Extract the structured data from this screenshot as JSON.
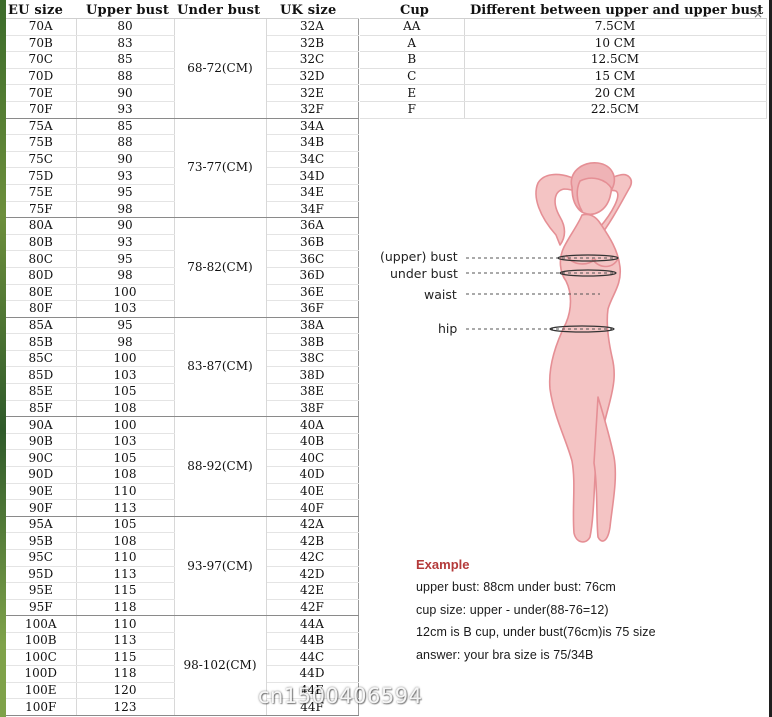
{
  "size_table": {
    "headers": {
      "eu": "EU size",
      "upper": "Upper bust",
      "under": "Under bust",
      "uk": "UK size"
    },
    "groups": [
      {
        "under": "68-72(CM)",
        "rows": [
          {
            "eu": "70A",
            "upper": "80",
            "uk": "32A"
          },
          {
            "eu": "70B",
            "upper": "83",
            "uk": "32B"
          },
          {
            "eu": "70C",
            "upper": "85",
            "uk": "32C"
          },
          {
            "eu": "70D",
            "upper": "88",
            "uk": "32D"
          },
          {
            "eu": "70E",
            "upper": "90",
            "uk": "32E"
          },
          {
            "eu": "70F",
            "upper": "93",
            "uk": "32F"
          }
        ]
      },
      {
        "under": "73-77(CM)",
        "rows": [
          {
            "eu": "75A",
            "upper": "85",
            "uk": "34A"
          },
          {
            "eu": "75B",
            "upper": "88",
            "uk": "34B"
          },
          {
            "eu": "75C",
            "upper": "90",
            "uk": "34C"
          },
          {
            "eu": "75D",
            "upper": "93",
            "uk": "34D"
          },
          {
            "eu": "75E",
            "upper": "95",
            "uk": "34E"
          },
          {
            "eu": "75F",
            "upper": "98",
            "uk": "34F"
          }
        ]
      },
      {
        "under": "78-82(CM)",
        "rows": [
          {
            "eu": "80A",
            "upper": "90",
            "uk": "36A"
          },
          {
            "eu": "80B",
            "upper": "93",
            "uk": "36B"
          },
          {
            "eu": "80C",
            "upper": "95",
            "uk": "36C"
          },
          {
            "eu": "80D",
            "upper": "98",
            "uk": "36D"
          },
          {
            "eu": "80E",
            "upper": "100",
            "uk": "36E"
          },
          {
            "eu": "80F",
            "upper": "103",
            "uk": "36F"
          }
        ]
      },
      {
        "under": "83-87(CM)",
        "rows": [
          {
            "eu": "85A",
            "upper": "95",
            "uk": "38A"
          },
          {
            "eu": "85B",
            "upper": "98",
            "uk": "38B"
          },
          {
            "eu": "85C",
            "upper": "100",
            "uk": "38C"
          },
          {
            "eu": "85D",
            "upper": "103",
            "uk": "38D"
          },
          {
            "eu": "85E",
            "upper": "105",
            "uk": "38E"
          },
          {
            "eu": "85F",
            "upper": "108",
            "uk": "38F"
          }
        ]
      },
      {
        "under": "88-92(CM)",
        "rows": [
          {
            "eu": "90A",
            "upper": "100",
            "uk": "40A"
          },
          {
            "eu": "90B",
            "upper": "103",
            "uk": "40B"
          },
          {
            "eu": "90C",
            "upper": "105",
            "uk": "40C"
          },
          {
            "eu": "90D",
            "upper": "108",
            "uk": "40D"
          },
          {
            "eu": "90E",
            "upper": "110",
            "uk": "40E"
          },
          {
            "eu": "90F",
            "upper": "113",
            "uk": "40F"
          }
        ]
      },
      {
        "under": "93-97(CM)",
        "rows": [
          {
            "eu": "95A",
            "upper": "105",
            "uk": "42A"
          },
          {
            "eu": "95B",
            "upper": "108",
            "uk": "42B"
          },
          {
            "eu": "95C",
            "upper": "110",
            "uk": "42C"
          },
          {
            "eu": "95D",
            "upper": "113",
            "uk": "42D"
          },
          {
            "eu": "95E",
            "upper": "115",
            "uk": "42E"
          },
          {
            "eu": "95F",
            "upper": "118",
            "uk": "42F"
          }
        ]
      },
      {
        "under": "98-102(CM)",
        "rows": [
          {
            "eu": "100A",
            "upper": "110",
            "uk": "44A"
          },
          {
            "eu": "100B",
            "upper": "113",
            "uk": "44B"
          },
          {
            "eu": "100C",
            "upper": "115",
            "uk": "44C"
          },
          {
            "eu": "100D",
            "upper": "118",
            "uk": "44D"
          },
          {
            "eu": "100E",
            "upper": "120",
            "uk": "44E"
          },
          {
            "eu": "100F",
            "upper": "123",
            "uk": "44F"
          }
        ]
      }
    ]
  },
  "cup_table": {
    "headers": {
      "cup": "Cup",
      "diff": "Different between upper and upper bust"
    },
    "rows": [
      {
        "cup": "AA",
        "diff": "7.5CM"
      },
      {
        "cup": "A",
        "diff": "10 CM"
      },
      {
        "cup": "B",
        "diff": "12.5CM"
      },
      {
        "cup": "C",
        "diff": "15 CM"
      },
      {
        "cup": "E",
        "diff": "20 CM"
      },
      {
        "cup": "F",
        "diff": "22.5CM"
      }
    ]
  },
  "figure": {
    "labels": {
      "upper_bust": "(upper) bust",
      "under_bust": "under bust",
      "waist": "waist",
      "hip": "hip"
    },
    "skin_color": "#f4c4c4",
    "outline_color": "#e58f95"
  },
  "example": {
    "title": "Example",
    "lines": [
      "upper bust: 88cm  under bust: 76cm",
      "cup size: upper - under(88-76=12)",
      "12cm is B cup, under bust(76cm)is 75 size",
      "answer: your bra size is 75/34B"
    ],
    "title_color": "#b43a3a"
  },
  "watermark": "cn1500406594",
  "close_icon": "×"
}
